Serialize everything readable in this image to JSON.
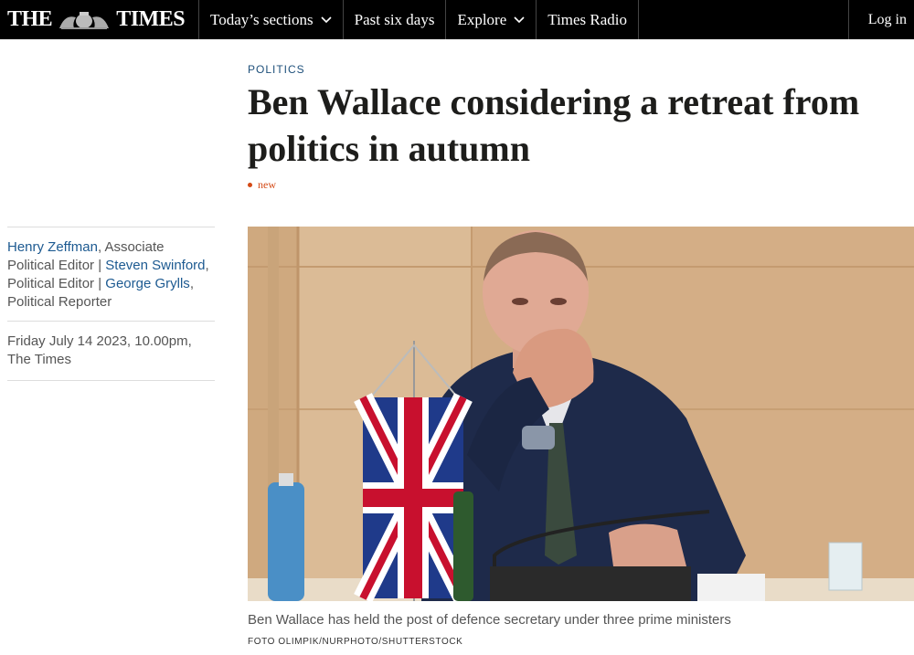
{
  "nav": {
    "logo_left": "THE",
    "logo_right": "TIMES",
    "items": [
      {
        "label": "Today’s sections",
        "has_dropdown": true
      },
      {
        "label": "Past six days",
        "has_dropdown": false
      },
      {
        "label": "Explore",
        "has_dropdown": true
      },
      {
        "label": "Times Radio",
        "has_dropdown": false
      }
    ],
    "login_label": "Log in"
  },
  "article": {
    "section": "POLITICS",
    "headline": "Ben Wallace considering a retreat from politics in autumn",
    "flag": "new",
    "byline": {
      "authors": [
        {
          "name": "Henry Zeffman",
          "role": ", Associate Political Editor | "
        },
        {
          "name": "Steven Swinford",
          "role": ", Political Editor | "
        },
        {
          "name": "George Grylls",
          "role": ", Political Reporter"
        }
      ],
      "date": "Friday July 14 2023, 10.00pm, The Times"
    },
    "image": {
      "caption": "Ben Wallace has held the post of defence secretary under three prime ministers",
      "credit": "FOTO OLIMPIK/NURPHOTO/SHUTTERSTOCK"
    }
  },
  "colors": {
    "nav_bg": "#000000",
    "link": "#1d5a91",
    "flag": "#d44a16",
    "section": "#1d4f7a"
  }
}
